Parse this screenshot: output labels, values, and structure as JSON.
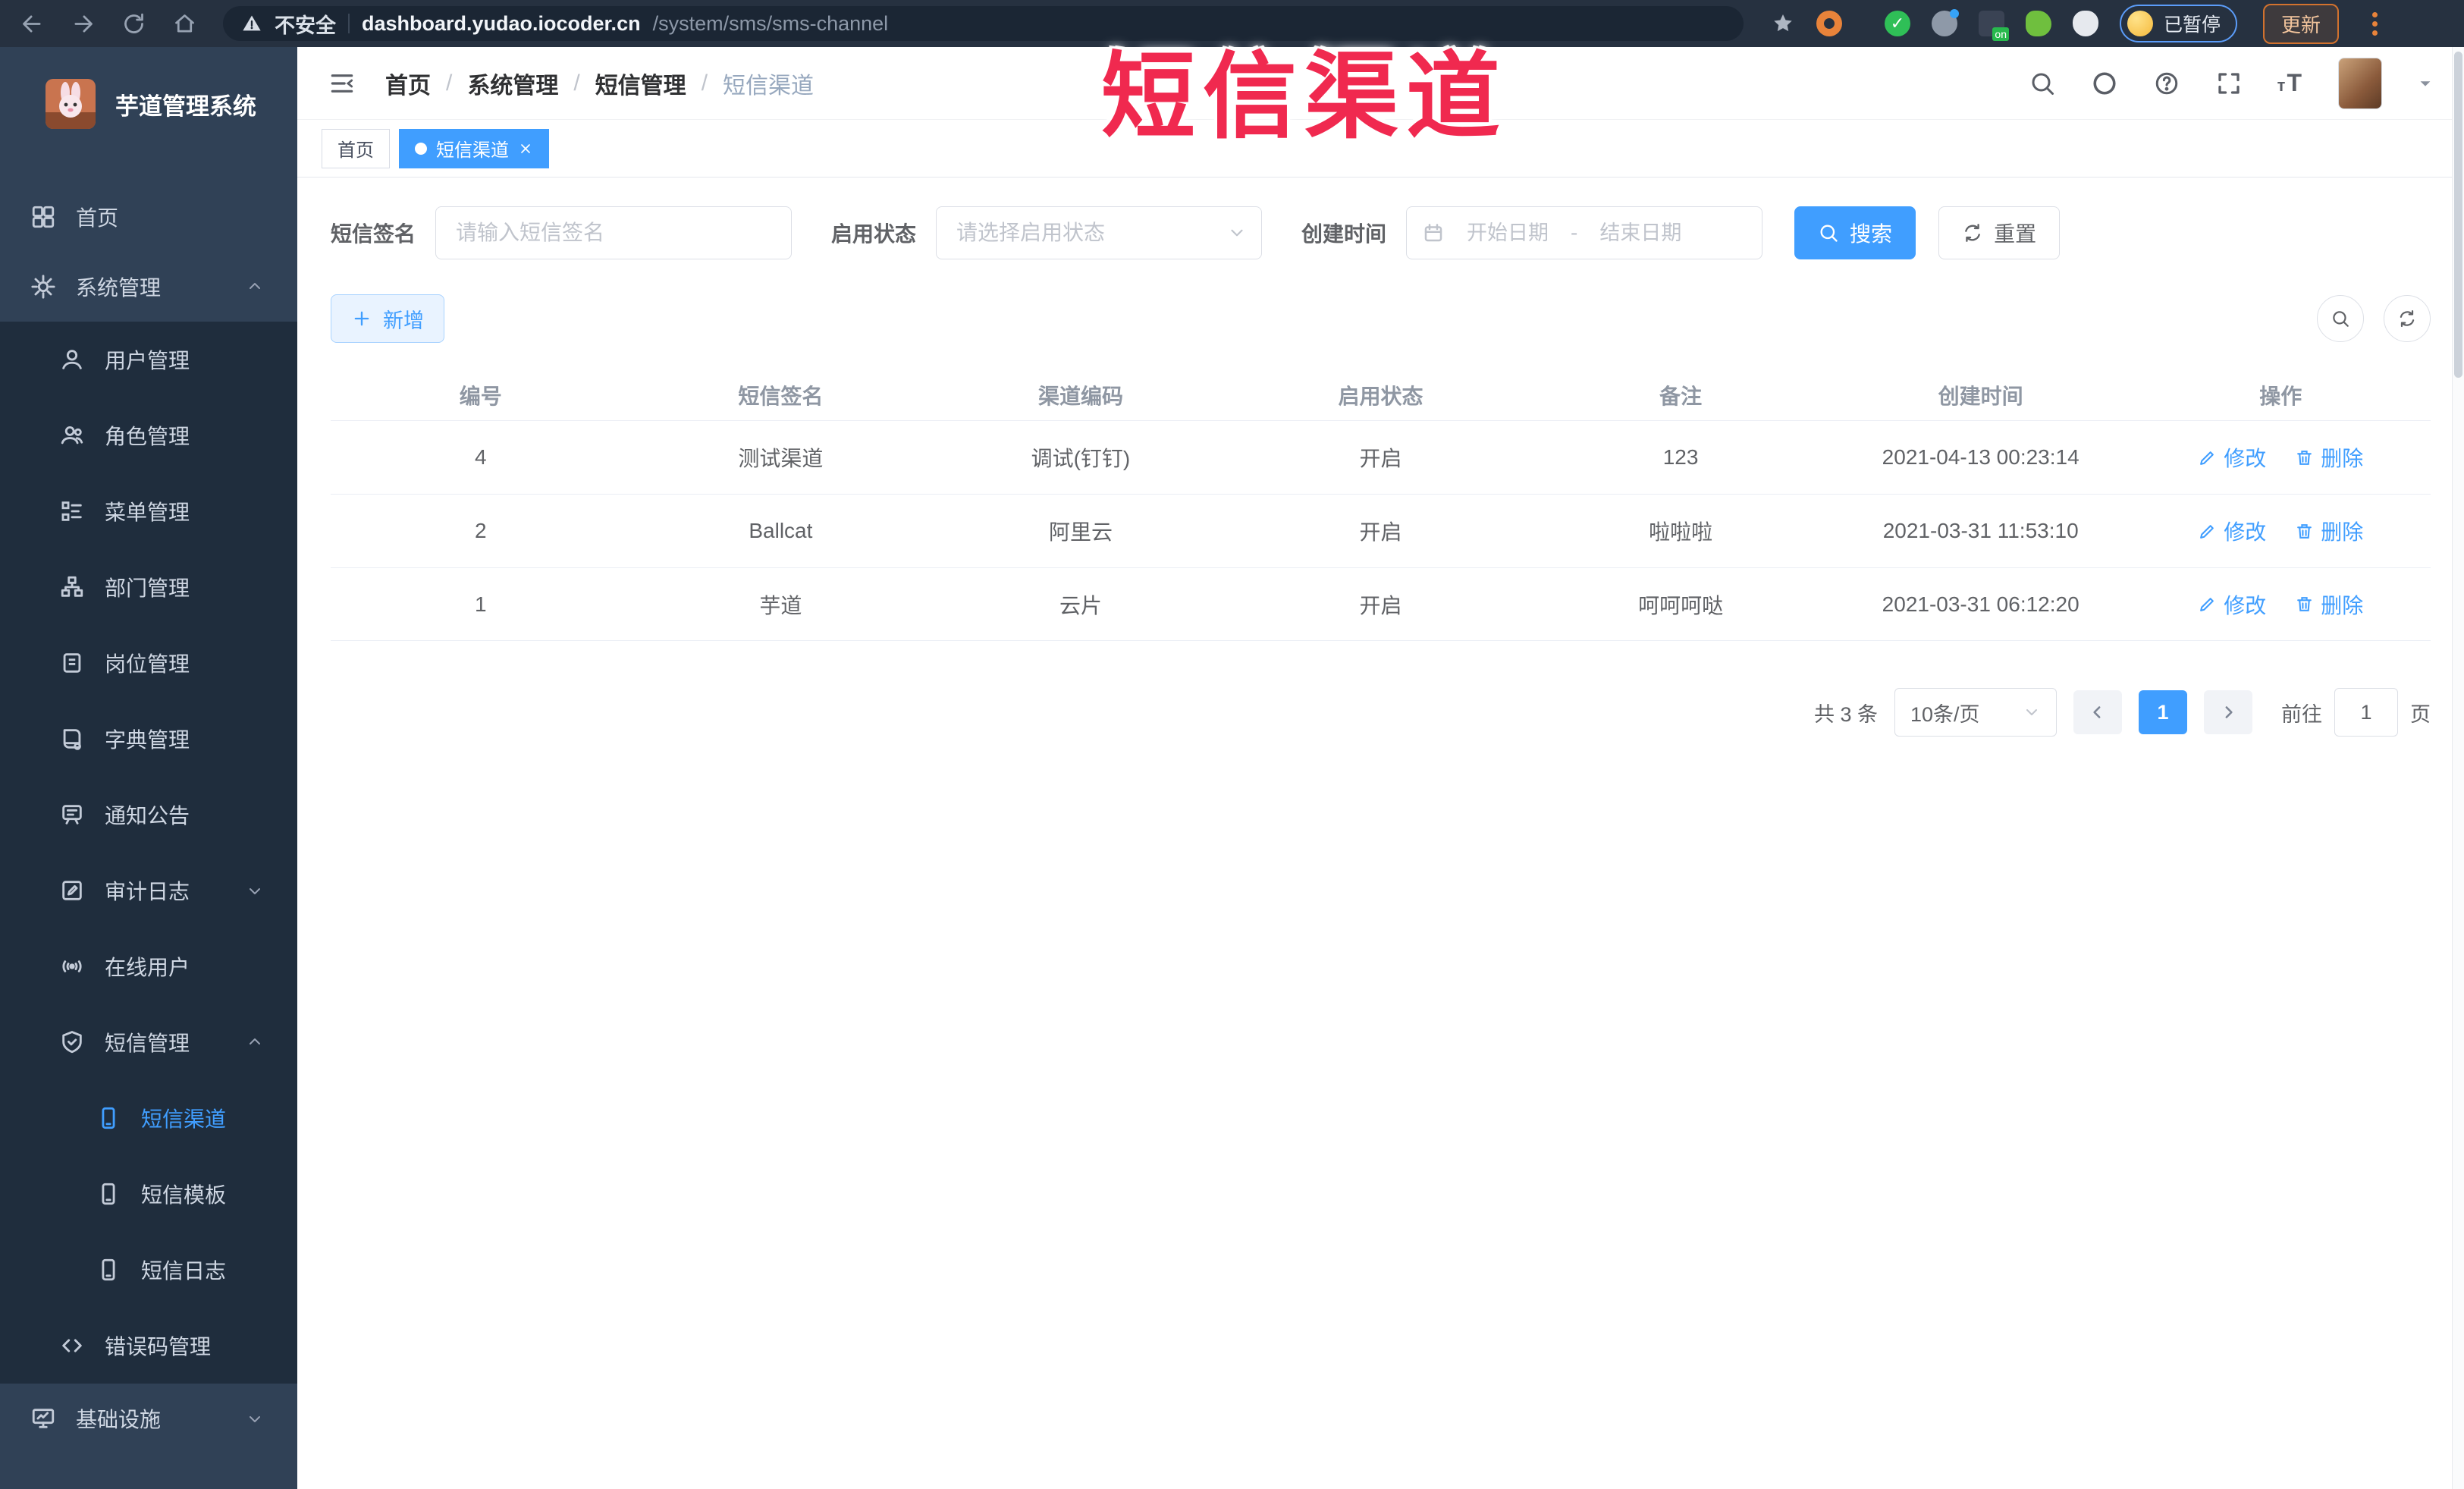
{
  "browser": {
    "security_label": "不安全",
    "url_domain": "dashboard.yudao.iocoder.cn",
    "url_path": "/system/sms/sms-channel",
    "paused_label": "已暂停",
    "update_label": "更新"
  },
  "watermark": "短信渠道",
  "sidebar": {
    "title": "芋道管理系统",
    "items": [
      {
        "label": "首页"
      },
      {
        "label": "系统管理"
      },
      {
        "label": "用户管理"
      },
      {
        "label": "角色管理"
      },
      {
        "label": "菜单管理"
      },
      {
        "label": "部门管理"
      },
      {
        "label": "岗位管理"
      },
      {
        "label": "字典管理"
      },
      {
        "label": "通知公告"
      },
      {
        "label": "审计日志"
      },
      {
        "label": "在线用户"
      },
      {
        "label": "短信管理"
      },
      {
        "label": "短信渠道",
        "active": true
      },
      {
        "label": "短信模板"
      },
      {
        "label": "短信日志"
      },
      {
        "label": "错误码管理"
      },
      {
        "label": "基础设施"
      }
    ]
  },
  "breadcrumb": {
    "separator": "/",
    "items": [
      "首页",
      "系统管理",
      "短信管理",
      "短信渠道"
    ]
  },
  "tags": [
    {
      "label": "首页"
    },
    {
      "label": "短信渠道"
    }
  ],
  "search": {
    "sign_label": "短信签名",
    "sign_placeholder": "请输入短信签名",
    "status_label": "启用状态",
    "status_placeholder": "请选择启用状态",
    "time_label": "创建时间",
    "start_placeholder": "开始日期",
    "range_separator": "-",
    "end_placeholder": "结束日期",
    "search_label": "搜索",
    "reset_label": "重置"
  },
  "toolbar": {
    "add_label": "新增"
  },
  "table": {
    "columns": [
      "编号",
      "短信签名",
      "渠道编码",
      "启用状态",
      "备注",
      "创建时间",
      "操作"
    ],
    "ops": {
      "edit": "修改",
      "delete": "删除"
    },
    "rows": [
      {
        "cells": [
          "4",
          "测试渠道",
          "调试(钉钉)",
          "开启",
          "123",
          "2021-04-13 00:23:14"
        ]
      },
      {
        "cells": [
          "2",
          "Ballcat",
          "阿里云",
          "开启",
          "啦啦啦",
          "2021-03-31 11:53:10"
        ]
      },
      {
        "cells": [
          "1",
          "芋道",
          "云片",
          "开启",
          "呵呵呵哒",
          "2021-03-31 06:12:20"
        ]
      }
    ]
  },
  "pagination": {
    "total_text": "共 3 条",
    "page_size": "10条/页",
    "current_page": "1",
    "goto_label": "前往",
    "goto_value": "1",
    "page_suffix": "页"
  },
  "colors": {
    "accent": "#409eff",
    "sidebar_bg": "#304156",
    "submenu_bg": "#1f2d3d",
    "watermark_red": "#f0294f"
  }
}
